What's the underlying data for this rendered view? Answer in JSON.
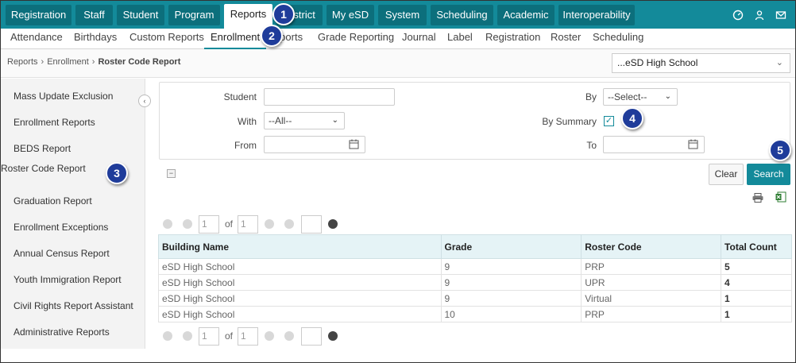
{
  "top_nav": {
    "tabs": [
      {
        "label": "Registration"
      },
      {
        "label": "Staff"
      },
      {
        "label": "Student"
      },
      {
        "label": "Program"
      },
      {
        "label": "Reports"
      },
      {
        "label": "District"
      },
      {
        "label": "My eSD"
      },
      {
        "label": "System"
      },
      {
        "label": "Scheduling"
      },
      {
        "label": "Academic"
      },
      {
        "label": "Interoperability"
      }
    ],
    "active_tab": "Reports",
    "icons": [
      "dashboard-icon",
      "user-icon",
      "mail-icon"
    ]
  },
  "sub_nav": {
    "items": [
      {
        "label": "Attendance"
      },
      {
        "label": "Birthdays"
      },
      {
        "label": "Custom Reports"
      },
      {
        "label": "Enrollment"
      },
      {
        "label": "Exports"
      },
      {
        "label": "Grade Reporting"
      },
      {
        "label": "Journal"
      },
      {
        "label": "Label"
      },
      {
        "label": "Registration"
      },
      {
        "label": "Roster"
      },
      {
        "label": "Scheduling"
      }
    ],
    "active_item": "Enrollment"
  },
  "breadcrumb": {
    "items": [
      "Reports",
      "Enrollment",
      "Roster Code Report"
    ]
  },
  "school_selector": {
    "value": "...eSD High School"
  },
  "sidebar": {
    "items": [
      {
        "label": "Mass Update Exclusion"
      },
      {
        "label": "Enrollment Reports"
      },
      {
        "label": "BEDS Report"
      },
      {
        "label": "Roster Code Report"
      },
      {
        "label": "Graduation Report"
      },
      {
        "label": "Enrollment Exceptions"
      },
      {
        "label": "Annual Census Report"
      },
      {
        "label": "Youth Immigration Report"
      },
      {
        "label": "Civil Rights Report Assistant"
      },
      {
        "label": "Administrative Reports"
      }
    ],
    "active_item": "Roster Code Report"
  },
  "filters": {
    "student_label": "Student",
    "student_value": "",
    "with_label": "With",
    "with_value": "--All--",
    "from_label": "From",
    "from_value": "",
    "by_label": "By",
    "by_value": "--Select--",
    "by_summary_label": "By Summary",
    "by_summary_checked": true,
    "to_label": "To",
    "to_value": ""
  },
  "buttons": {
    "clear": "Clear",
    "search": "Search"
  },
  "pager": {
    "page": "1",
    "of_label": "of",
    "total_pages": "1",
    "page_size": ""
  },
  "table": {
    "columns": [
      "Building Name",
      "Grade",
      "Roster Code",
      "Total Count"
    ],
    "rows": [
      {
        "building": "eSD High School",
        "grade": "9",
        "roster_code": "PRP",
        "total": "5"
      },
      {
        "building": "eSD High School",
        "grade": "9",
        "roster_code": "UPR",
        "total": "4"
      },
      {
        "building": "eSD High School",
        "grade": "9",
        "roster_code": "Virtual",
        "total": "1"
      },
      {
        "building": "eSD High School",
        "grade": "10",
        "roster_code": "PRP",
        "total": "1"
      }
    ]
  },
  "callouts": [
    "1",
    "2",
    "3",
    "4",
    "5"
  ],
  "colors": {
    "brand_teal": "#138a9a",
    "tab_dark": "#0c6f7c",
    "callout_blue": "#1f3c9a",
    "table_header": "#e5f3f6"
  }
}
